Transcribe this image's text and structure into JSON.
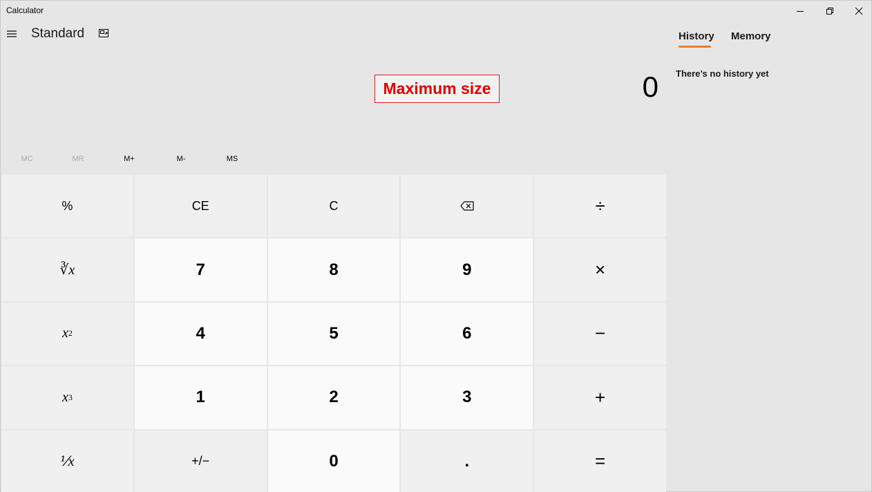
{
  "window": {
    "title": "Calculator",
    "minimize_icon": "minimize-icon",
    "maximize_icon": "restore-icon",
    "close_icon": "close-icon"
  },
  "header": {
    "menu_icon": "hamburger-icon",
    "mode_title": "Standard",
    "keep_on_top_icon": "keep-on-top-icon"
  },
  "overlay": {
    "label": "Maximum size",
    "color": "#e00000"
  },
  "display": {
    "value": "0"
  },
  "memory": {
    "mc": "MC",
    "mr": "MR",
    "m_plus": "M+",
    "m_minus": "M-",
    "ms": "MS"
  },
  "keypad": {
    "percent": "%",
    "ce": "CE",
    "c": "C",
    "backspace_icon": "backspace-icon",
    "divide": "÷",
    "sqrt": "∛x",
    "seven": "7",
    "eight": "8",
    "nine": "9",
    "multiply": "×",
    "square": "x",
    "square_exp": "2",
    "four": "4",
    "five": "5",
    "six": "6",
    "minus": "−",
    "cube": "x",
    "cube_exp": "3",
    "one": "1",
    "two": "2",
    "three": "3",
    "plus": "+",
    "reciprocal": "⅟x",
    "negate": "+/−",
    "zero": "0",
    "decimal": ".",
    "equals": "="
  },
  "panel": {
    "tabs": [
      {
        "label": "History",
        "active": true
      },
      {
        "label": "Memory",
        "active": false
      }
    ],
    "accent_color": "#e67e2e",
    "history_empty_text": "There’s no history yet"
  }
}
